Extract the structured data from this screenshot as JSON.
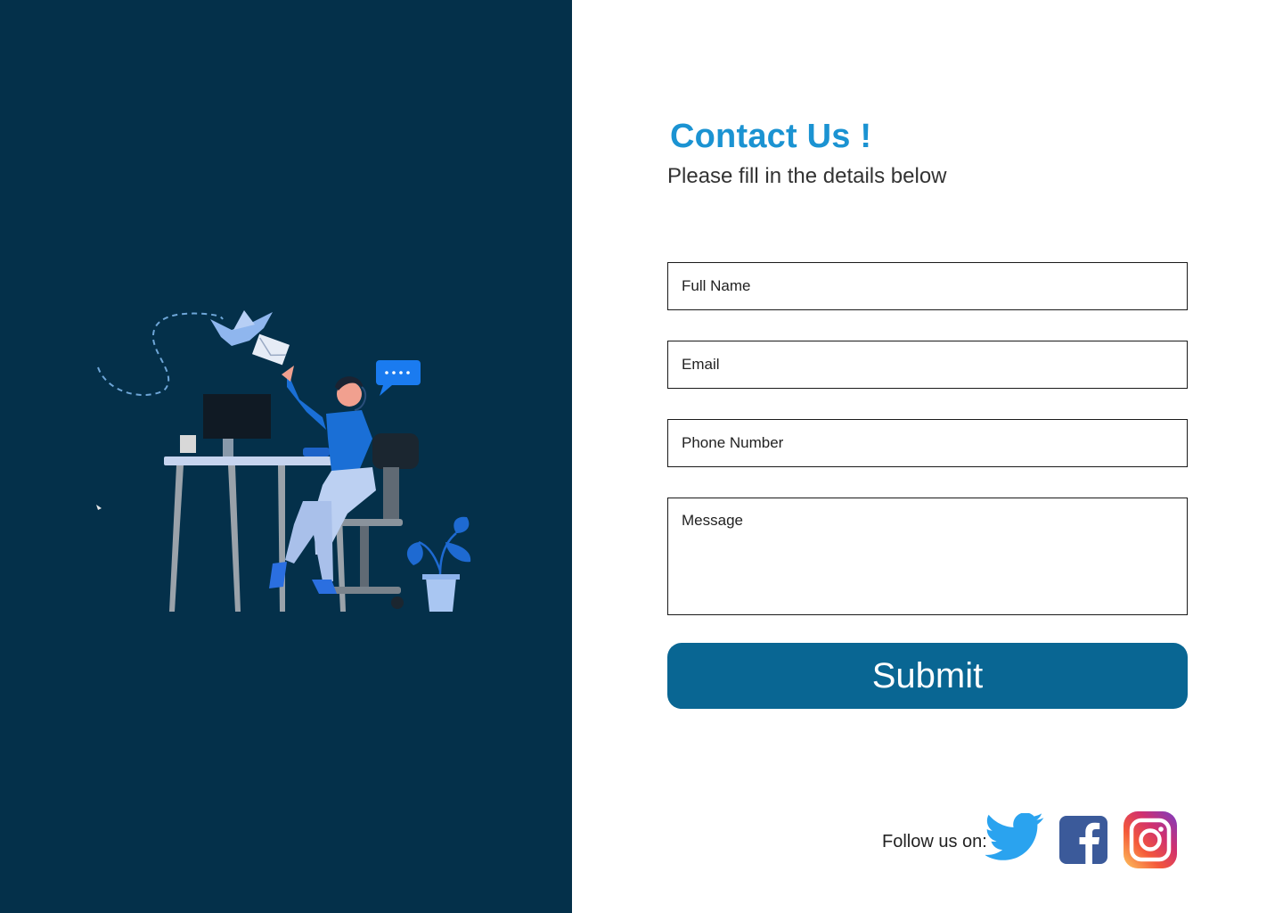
{
  "contact": {
    "title": "Contact Us !",
    "subtitle": "Please fill in the details below"
  },
  "form": {
    "full_name_placeholder": "Full Name",
    "email_placeholder": "Email",
    "phone_placeholder": "Phone Number",
    "message_placeholder": "Message",
    "submit_label": "Submit"
  },
  "social": {
    "label": "Follow us on:",
    "icons": [
      "twitter-icon",
      "facebook-icon",
      "instagram-icon"
    ]
  },
  "colors": {
    "panel_bg": "#04304a",
    "title": "#1b93d2",
    "submit_bg": "#096693"
  }
}
